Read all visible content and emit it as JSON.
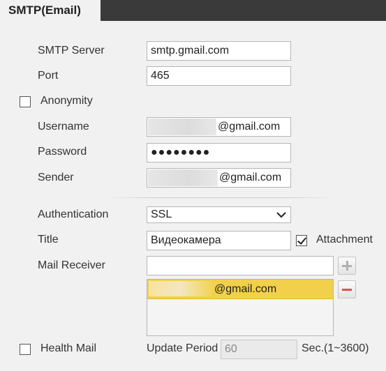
{
  "tab": {
    "label": "SMTP(Email)"
  },
  "form": {
    "smtp_server": {
      "label": "SMTP Server",
      "value": "smtp.gmail.com"
    },
    "port": {
      "label": "Port",
      "value": "465"
    },
    "anonymity": {
      "label": "Anonymity",
      "checked": false
    },
    "username": {
      "label": "Username",
      "value_suffix": "@gmail.com"
    },
    "password": {
      "label": "Password",
      "value": "●●●●●●●●"
    },
    "sender": {
      "label": "Sender",
      "value_suffix": "@gmail.com"
    },
    "authentication": {
      "label": "Authentication",
      "selected": "SSL"
    },
    "title": {
      "label": "Title",
      "value": "Видеокамера"
    },
    "attachment": {
      "label": "Attachment",
      "checked": true
    },
    "mail_receiver": {
      "label": "Mail Receiver",
      "value": "",
      "list": [
        {
          "suffix": "@gmail.com"
        }
      ]
    },
    "health_mail": {
      "label": "Health Mail",
      "checked": false
    },
    "update_period": {
      "label": "Update Period",
      "value": "60",
      "unit": "Sec.(1~3600)"
    }
  },
  "icons": {
    "add": "plus-icon",
    "remove": "minus-icon",
    "dropdown": "chevron-down-icon"
  },
  "colors": {
    "tab_bar": "#3a3a3a",
    "selected_row": "#f2d04b",
    "remove_icon": "#d9534f"
  }
}
